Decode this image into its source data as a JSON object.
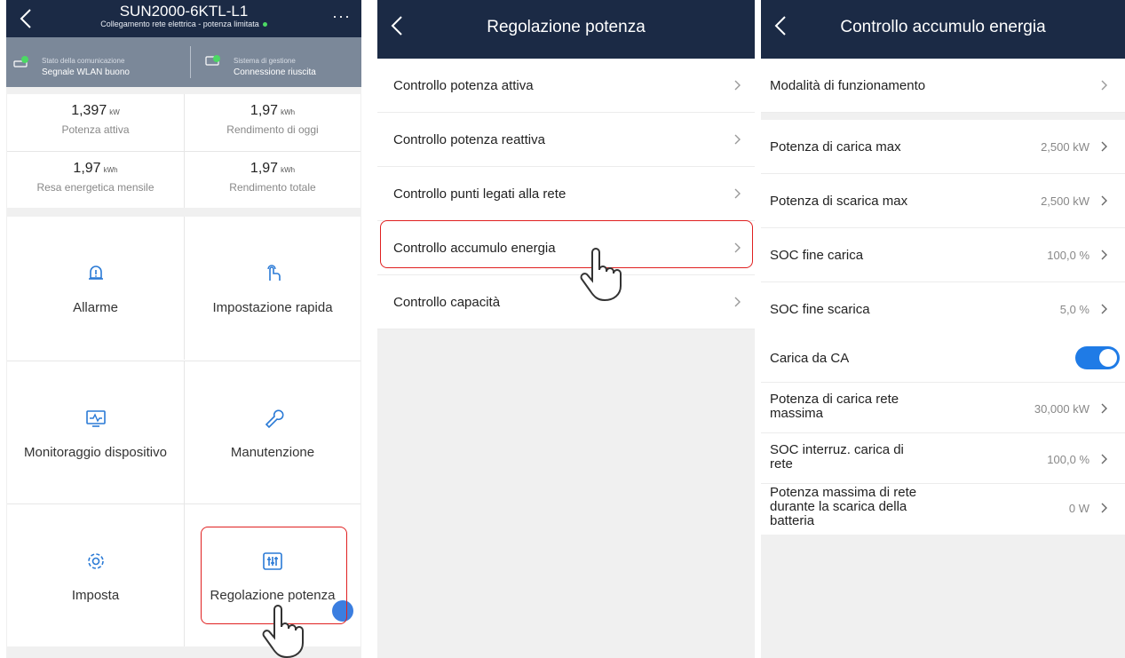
{
  "screen1": {
    "device_name": "SUN2000-6KTL-L1",
    "device_subtitle": "Collegamento rete elettrica - potenza limitata",
    "more": "···",
    "comm": {
      "label": "Stato della comunicazione",
      "value": "Segnale WLAN buono"
    },
    "mgmt": {
      "label": "Sistema di gestione",
      "value": "Connessione riuscita"
    },
    "stats": [
      {
        "value": "1,397",
        "unit": "kW",
        "caption": "Potenza attiva"
      },
      {
        "value": "1,97",
        "unit": "kWh",
        "caption": "Rendimento di oggi"
      },
      {
        "value": "1,97",
        "unit": "kWh",
        "caption": "Resa energetica mensile"
      },
      {
        "value": "1,97",
        "unit": "kWh",
        "caption": "Rendimento totale"
      }
    ],
    "tiles": [
      {
        "label": "Allarme",
        "icon": "bell-alert-icon"
      },
      {
        "label": "Impostazione rapida",
        "icon": "quick-setting-icon"
      },
      {
        "label": "Monitoraggio dispositivo",
        "icon": "monitor-icon"
      },
      {
        "label": "Manutenzione",
        "icon": "wrench-icon"
      },
      {
        "label": "Imposta",
        "icon": "gear-icon"
      },
      {
        "label": "Regolazione potenza",
        "icon": "sliders-icon"
      }
    ]
  },
  "screen2": {
    "title": "Regolazione potenza",
    "items": [
      "Controllo potenza attiva",
      "Controllo potenza reattiva",
      "Controllo punti legati alla rete",
      "Controllo accumulo energia",
      "Controllo capacità"
    ]
  },
  "screen3": {
    "title": "Controllo accumulo energia",
    "mode": "Modalità di funzionamento",
    "group1": [
      {
        "label": "Potenza di carica max",
        "value": "2,500 kW"
      },
      {
        "label": "Potenza di scarica max",
        "value": "2,500 kW"
      },
      {
        "label": "SOC fine carica",
        "value": "100,0 %"
      },
      {
        "label": "SOC fine scarica",
        "value": "5,0 %"
      }
    ],
    "ac_charge": {
      "label": "Carica da CA",
      "enabled": true
    },
    "group2": [
      {
        "label_l1": "Potenza di carica rete",
        "label_l2": "massima",
        "label_l3": "",
        "value": "30,000 kW"
      },
      {
        "label_l1": "SOC interruz. carica di",
        "label_l2": "rete",
        "label_l3": "",
        "value": "100,0 %"
      },
      {
        "label_l1": "Potenza massima di rete",
        "label_l2": "durante la scarica della",
        "label_l3": "batteria",
        "value": "0 W"
      }
    ]
  },
  "colors": {
    "header": "#1b2a45",
    "status": "#7b8899",
    "accent": "#1f7be6",
    "highlight": "#e02020"
  }
}
